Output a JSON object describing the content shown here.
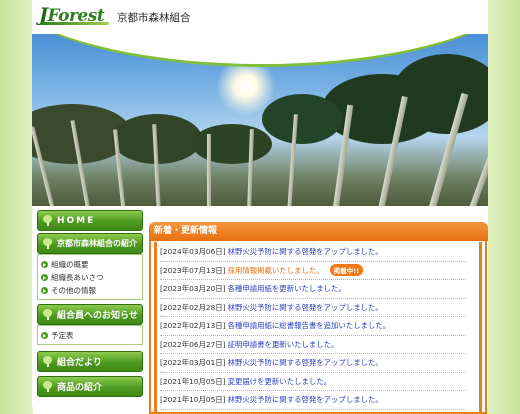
{
  "header": {
    "logo_text": "Forest",
    "logo_initial": "J",
    "org_name": "京都市森林組合"
  },
  "sidebar": {
    "items": [
      {
        "label": "HOME"
      },
      {
        "label": "京都市森林組合の紹介",
        "sub": [
          "組織の概要",
          "組織長あいさつ",
          "その他の情報"
        ]
      },
      {
        "label": "組合員へのお知らせ",
        "sub": [
          "予定表"
        ]
      },
      {
        "label": "組合だより"
      },
      {
        "label": "商品の紹介"
      }
    ]
  },
  "news": {
    "title": "新着・更新情報",
    "badge": "掲載中!!",
    "items": [
      {
        "date": "[2024年03月06日]",
        "text": "林野火災予防に関する啓発をアップしました。"
      },
      {
        "date": "[2023年07月13日]",
        "text": "採用情報掲載いたしました。"
      },
      {
        "date": "[2023年03月20日]",
        "text": "各種申請用紙を更新いたしました。"
      },
      {
        "date": "[2022年02月28日]",
        "text": "林野火災予防に関する啓発をアップしました。"
      },
      {
        "date": "[2022年02月13日]",
        "text": "各種申請用紙に総書報告書を追加いたしました。"
      },
      {
        "date": "[2022年06月27日]",
        "text": "証明申請書を更新いたしました。"
      },
      {
        "date": "[2022年03月01日]",
        "text": "林野火災予防に関する啓発をアップしました。"
      },
      {
        "date": "[2021年10月05日]",
        "text": "変更届けを更新いたしました。"
      },
      {
        "date": "[2021年10月05日]",
        "text": "林野火災予防に関する啓発をアップしました。"
      }
    ]
  },
  "colors": {
    "accent_green": "#4e9a22",
    "accent_orange": "#ee7d1e",
    "link_blue": "#2a3fbf"
  }
}
